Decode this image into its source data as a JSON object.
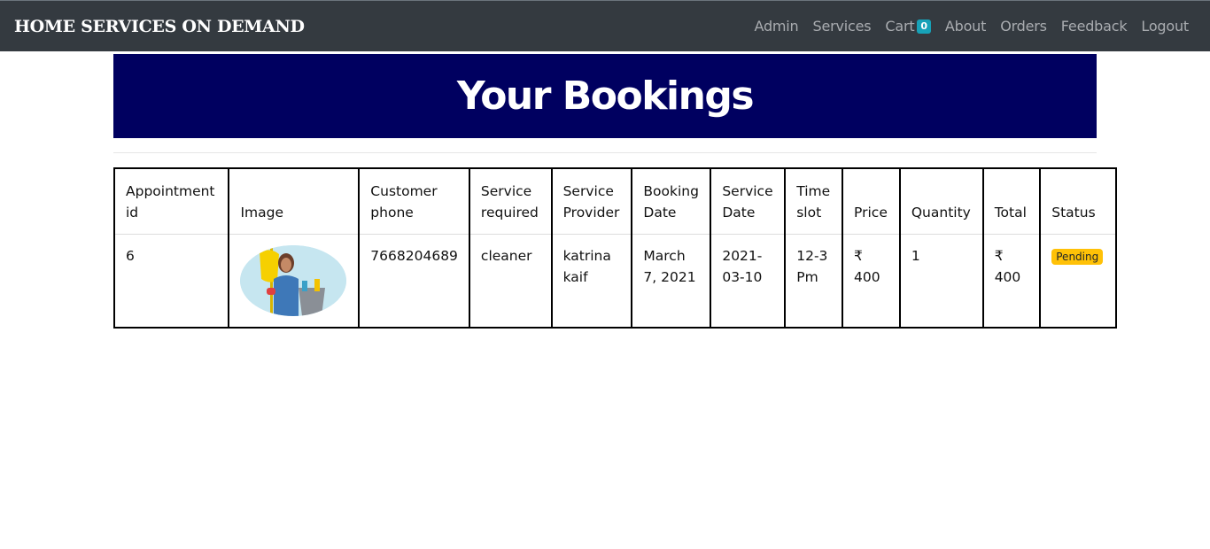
{
  "navbar": {
    "brand": "HOME SERVICES ON DEMAND",
    "links": {
      "admin": "Admin",
      "services": "Services",
      "cart": "Cart",
      "cart_count": "0",
      "about": "About",
      "orders": "Orders",
      "feedback": "Feedback",
      "logout": "Logout"
    }
  },
  "page": {
    "title": "Your Bookings"
  },
  "table": {
    "headers": [
      "Appointment id",
      "Image",
      "Customer phone",
      "Service required",
      "Service Provider",
      "Booking Date",
      "Service Date",
      "Time slot",
      "Price",
      "Quantity",
      "Total",
      "Status"
    ],
    "rows": [
      {
        "appointment_id": "6",
        "image": "cleaner-woman-photo",
        "customer_phone": "7668204689",
        "service_required": "cleaner",
        "service_provider": "katrina kaif",
        "booking_date": "March 7, 2021",
        "service_date": "2021-03-10",
        "time_slot": "12-3 Pm",
        "price": "₹ 400",
        "quantity": "1",
        "total": "₹ 400",
        "status": "Pending"
      }
    ]
  },
  "colors": {
    "navbar_bg": "#343a40",
    "banner_bg": "#000060",
    "cart_badge": "#17a2b8",
    "status_pending": "#ffc107"
  }
}
